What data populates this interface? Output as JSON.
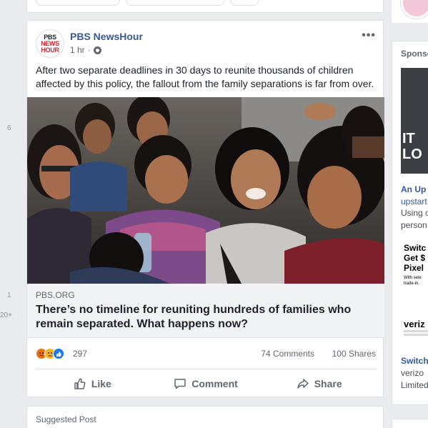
{
  "left_rail": {
    "counts": [
      "6",
      "1",
      "20+"
    ]
  },
  "post": {
    "page_name": "PBS NewsHour",
    "avatar_lines": [
      "PBS",
      "NEWS",
      "HOUR"
    ],
    "time": "1 hr",
    "more_label": "•••",
    "text": "After two separate deadlines in 30 days to reunite thousands of children affected by this policy, the fallout from the family separations is far from over.",
    "link": {
      "domain": "PBS.ORG",
      "title": "There’s no timeline for reuniting hundreds of families who remain separated. What happens now?"
    },
    "reactions": {
      "icons": [
        "angry-reaction",
        "sad-reaction",
        "like-reaction"
      ],
      "count": "297",
      "comments": "74 Comments",
      "shares": "100 Shares"
    },
    "actions": {
      "like": "Like",
      "comment": "Comment",
      "share": "Share"
    }
  },
  "suggested": {
    "label": "Suggested Post"
  },
  "right_rail": {
    "header": "Sponso",
    "ad_image_text": [
      "IT",
      "LO"
    ],
    "ad1_title": "An Up",
    "ad1_lines": [
      "upstart",
      "Using c",
      "person"
    ],
    "ad2_image_text": [
      "Switc",
      "Get $",
      "Pixel"
    ],
    "ad2_image_small": [
      "With sele",
      "trade-in."
    ],
    "ad2_brand": "veriz",
    "ad2_title": "Switch",
    "ad2_lines": [
      "verizo",
      "Limited"
    ]
  },
  "colors": {
    "link_blue": "#365899",
    "fb_bg": "#e9ebee",
    "ad_title_blue": "#365899",
    "pbs_red": "#d22630"
  }
}
